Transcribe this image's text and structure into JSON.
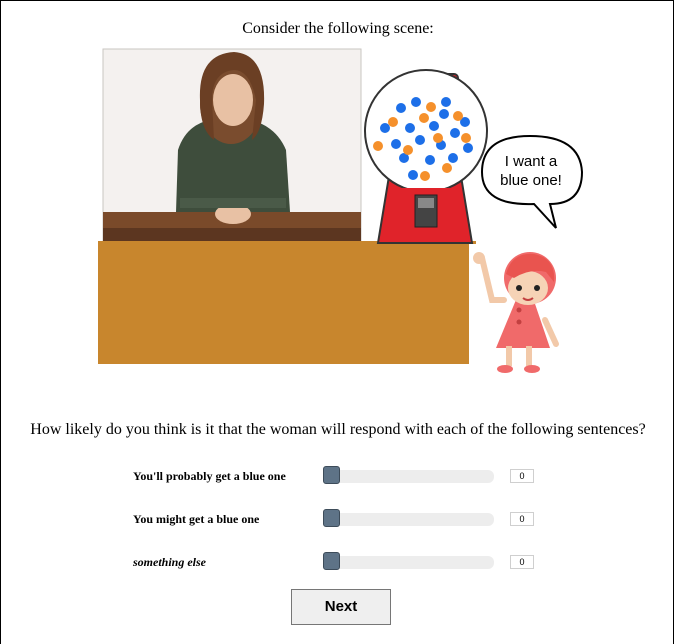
{
  "page": {
    "heading": "Consider the following scene:",
    "question": "How likely do you think is it that the woman will respond with each of the following sentences?"
  },
  "scene": {
    "speech_bubble_line1": "I want a",
    "speech_bubble_line2": "blue one!",
    "colors": {
      "table": "#c8862d",
      "machine_red": "#e0232a",
      "ball_blue": "#1d6fe8",
      "ball_orange": "#f5902b"
    },
    "icons": [
      "woman-photo",
      "gumball-machine-icon",
      "speech-bubble",
      "girl-character-icon"
    ]
  },
  "sliders": [
    {
      "label": "You'll probably get a blue one",
      "value": "0",
      "fraction": 0,
      "italic": false
    },
    {
      "label": "You might get a blue one",
      "value": "0",
      "fraction": 0,
      "italic": false
    },
    {
      "label": "something else",
      "value": "0",
      "fraction": 0,
      "italic": true
    }
  ],
  "next_button": {
    "label": "Next"
  }
}
